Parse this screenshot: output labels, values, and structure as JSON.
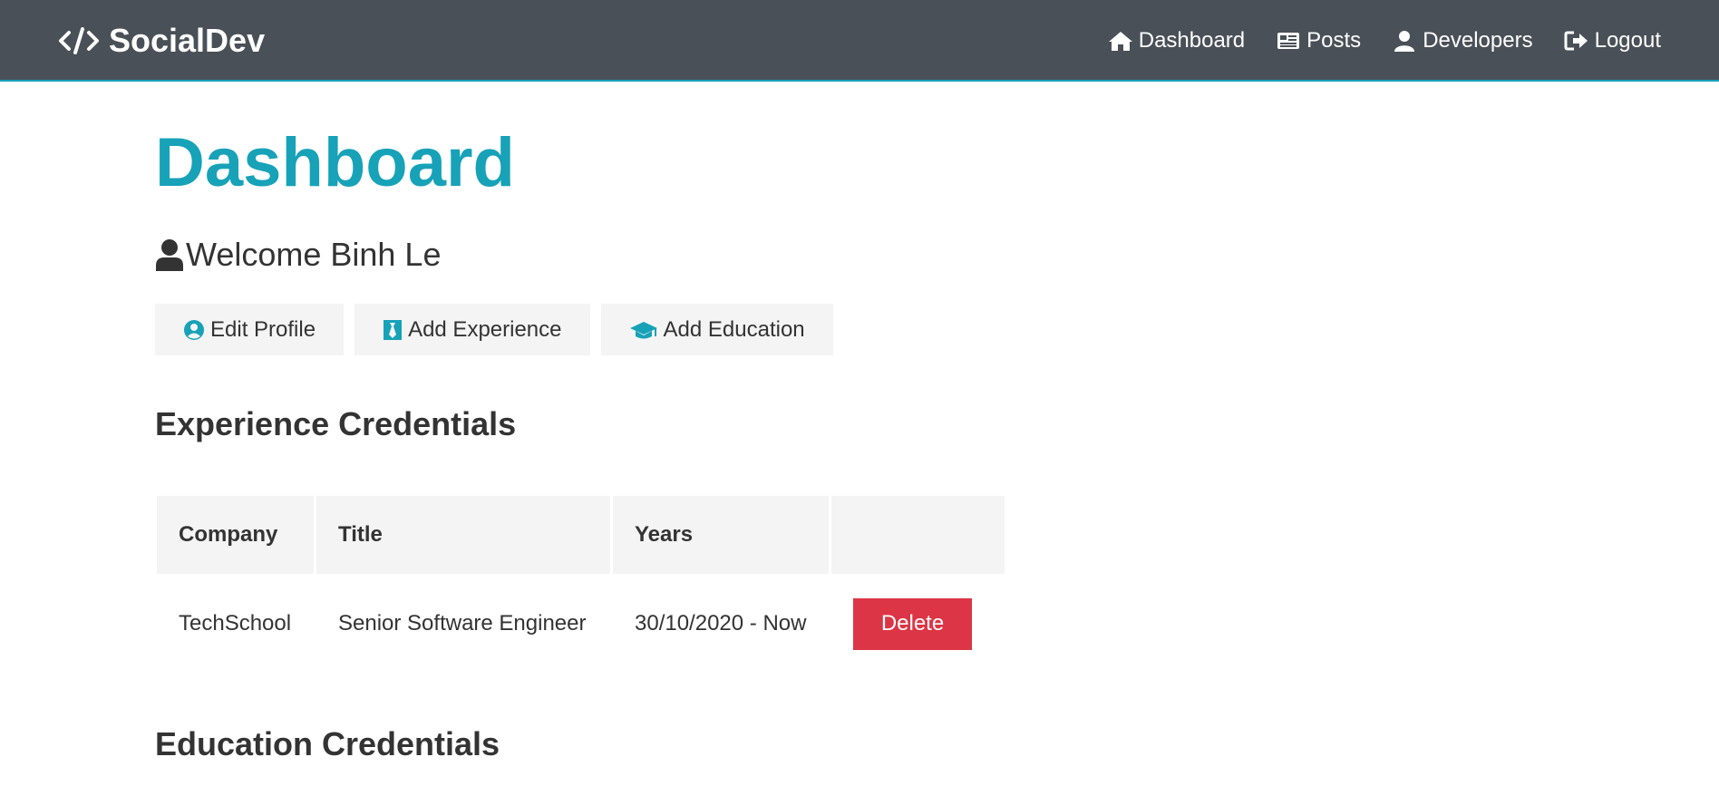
{
  "navbar": {
    "brand": "SocialDev",
    "brand_icon": "code-icon",
    "links": [
      {
        "label": "Dashboard",
        "icon": "home-icon"
      },
      {
        "label": "Posts",
        "icon": "newspaper-icon"
      },
      {
        "label": "Developers",
        "icon": "user-icon"
      },
      {
        "label": "Logout",
        "icon": "sign-out-icon"
      }
    ],
    "background": "#495057"
  },
  "page": {
    "title": "Dashboard",
    "welcome": "Welcome Binh Le",
    "accent": "#17a2b8"
  },
  "actions": {
    "edit_profile": "Edit Profile",
    "add_experience": "Add Experience",
    "add_education": "Add Education"
  },
  "experience": {
    "heading": "Experience Credentials",
    "columns": [
      "Company",
      "Title",
      "Years",
      ""
    ],
    "rows": [
      {
        "company": "TechSchool",
        "title": "Senior Software Engineer",
        "years": "30/10/2020 - Now",
        "action": "Delete"
      }
    ]
  },
  "education": {
    "heading": "Education Credentials"
  },
  "colors": {
    "danger": "#dc3545",
    "light": "#f4f4f4"
  }
}
